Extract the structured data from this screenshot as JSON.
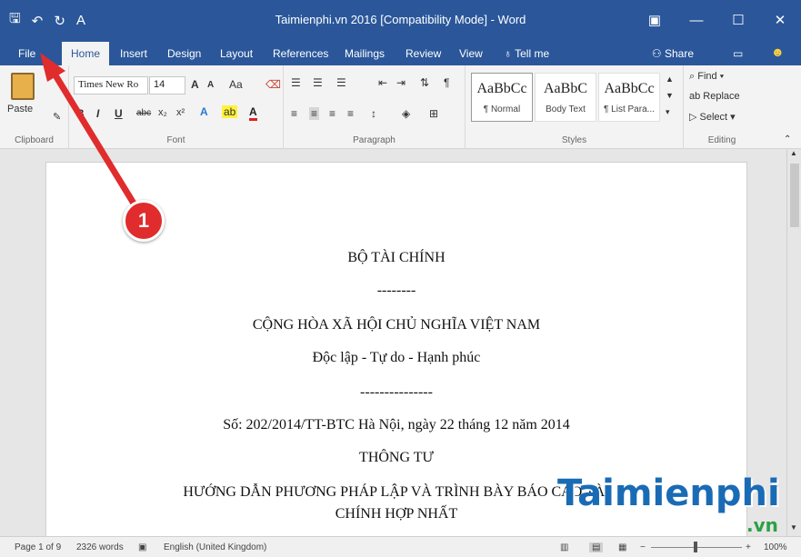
{
  "window": {
    "title": "Taimienphi.vn 2016 [Compatibility Mode] - Word",
    "qat": {
      "save": "🖫",
      "undo": "↶",
      "redo": "↻",
      "spell": "A"
    }
  },
  "tabs": [
    "File",
    "Home",
    "Insert",
    "Design",
    "Layout",
    "References",
    "Mailings",
    "Review",
    "View"
  ],
  "tell_me": "Tell me",
  "share": "Share",
  "ribbon": {
    "clipboard": {
      "paste": "Paste",
      "label": "Clipboard"
    },
    "font": {
      "name": "Times New Ro",
      "size": "14",
      "label": "Font",
      "buttons": [
        "B",
        "I",
        "U",
        "abc",
        "x₂",
        "x²"
      ],
      "grow": "A",
      "shrink": "A",
      "case": "Aa"
    },
    "paragraph": {
      "label": "Paragraph"
    },
    "styles": {
      "label": "Styles",
      "items": [
        {
          "preview": "AaBbCc",
          "name": "¶ Normal"
        },
        {
          "preview": "AaBbC",
          "name": "Body Text"
        },
        {
          "preview": "AaBbCc",
          "name": "¶ List Para..."
        }
      ]
    },
    "editing": {
      "label": "Editing",
      "find": "Find",
      "replace": "Replace",
      "select": "Select"
    }
  },
  "document": {
    "lines": [
      "BỘ TÀI CHÍNH",
      "--------",
      "CỘNG HÒA XÃ HỘI CHỦ NGHĨA VIỆT NAM",
      "Độc lập - Tự do - Hạnh phúc",
      "---------------",
      "Số: 202/2014/TT-BTC Hà Nội, ngày 22 tháng 12 năm 2014",
      "THÔNG TƯ",
      "HƯỚNG DẪN PHƯƠNG PHÁP LẬP VÀ TRÌNH BÀY BÁO CÁO TÀI",
      "CHÍNH HỢP NHẤT"
    ]
  },
  "status": {
    "page": "Page 1 of 9",
    "words": "2326 words",
    "language": "English (United Kingdom)",
    "zoom": "100%"
  },
  "annotation": {
    "step": "1"
  },
  "watermark": {
    "main": "Taimienphi",
    "sub": ".vn"
  },
  "colors": {
    "accent": "#2b579a",
    "arrow": "#e02c2c"
  }
}
